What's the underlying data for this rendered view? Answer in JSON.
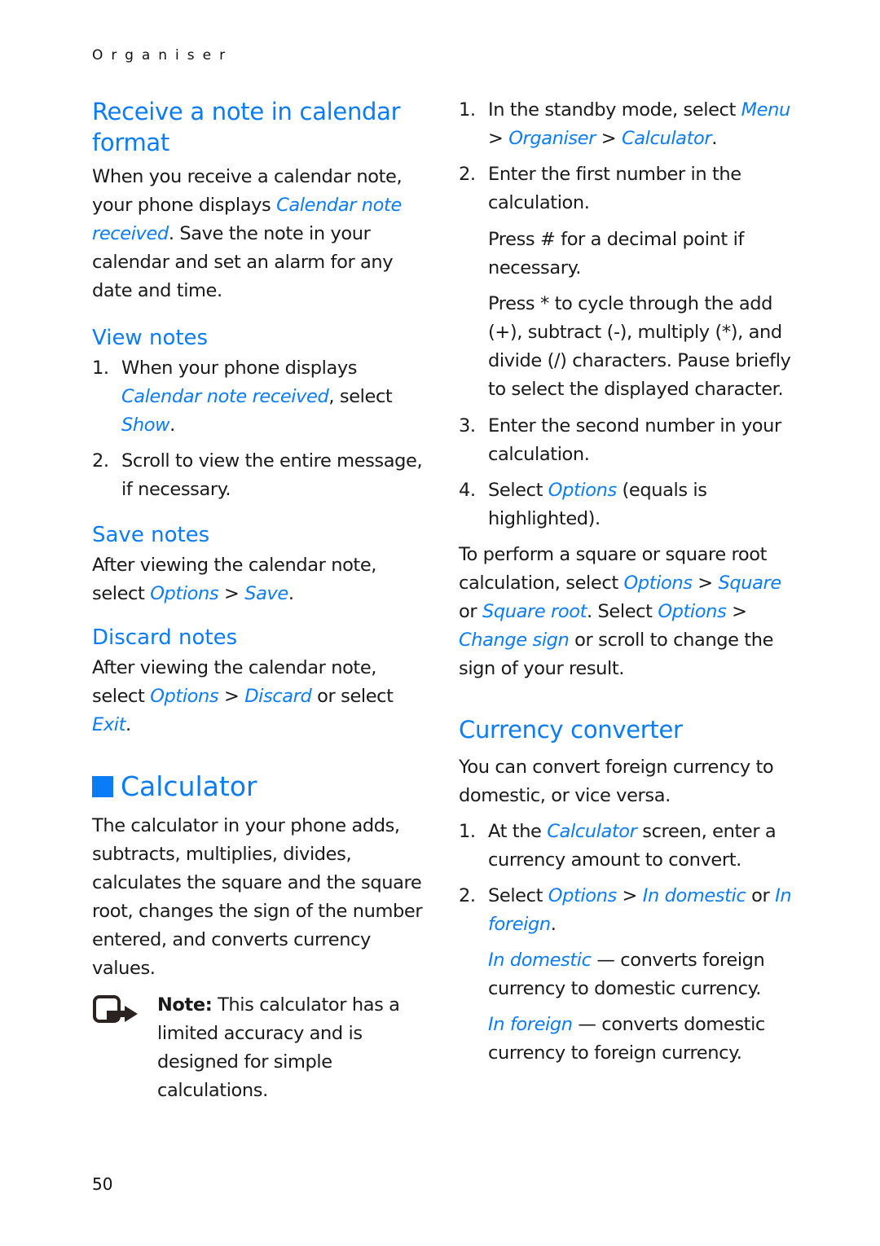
{
  "running_head": "Organiser",
  "page_number": "50",
  "left_column": {
    "receive_note": {
      "heading": "Receive a note in calendar format",
      "body": [
        {
          "t": "When you receive a calendar note, your phone displays "
        },
        {
          "t": "Calendar note received",
          "link": true
        },
        {
          "t": ". Save the note in your calendar and set an alarm for any date and time."
        }
      ]
    },
    "view_notes": {
      "heading": "View notes",
      "steps": [
        {
          "num": "1.",
          "parts": [
            {
              "t": "When your phone displays "
            },
            {
              "t": "Calendar note received",
              "link": true
            },
            {
              "t": ", select "
            },
            {
              "t": "Show",
              "link": true
            },
            {
              "t": "."
            }
          ]
        },
        {
          "num": "2.",
          "parts": [
            {
              "t": "Scroll to view the entire message, if necessary."
            }
          ]
        }
      ]
    },
    "save_notes": {
      "heading": "Save notes",
      "body": [
        {
          "t": "After viewing the calendar note, select "
        },
        {
          "t": "Options",
          "link": true
        },
        {
          "t": " > "
        },
        {
          "t": "Save",
          "link": true
        },
        {
          "t": "."
        }
      ]
    },
    "discard_notes": {
      "heading": "Discard notes",
      "body": [
        {
          "t": "After viewing the calendar note, select "
        },
        {
          "t": "Options",
          "link": true
        },
        {
          "t": " > "
        },
        {
          "t": "Discard",
          "link": true
        },
        {
          "t": " or select "
        },
        {
          "t": "Exit",
          "link": true
        },
        {
          "t": "."
        }
      ]
    },
    "calculator": {
      "heading": "Calculator",
      "body": "The calculator in your phone adds, subtracts, multiplies, divides, calculates the square and the square root, changes the sign of the number entered, and converts currency values.",
      "note_label": "Note:",
      "note_text": " This calculator has a limited accuracy and is designed for simple calculations."
    }
  },
  "right_column": {
    "calc_steps": [
      {
        "num": "1.",
        "parts": [
          {
            "t": "In the standby mode, select "
          },
          {
            "t": "Menu",
            "link": true
          },
          {
            "t": " > "
          },
          {
            "t": "Organiser",
            "link": true
          },
          {
            "t": " > "
          },
          {
            "t": "Calculator",
            "link": true
          },
          {
            "t": "."
          }
        ]
      },
      {
        "num": "2.",
        "parts": [
          {
            "t": "Enter the first number in the calculation."
          }
        ]
      }
    ],
    "press_hash": "Press # for a decimal point if necessary.",
    "press_star": "Press * to cycle through the add (+), subtract (-), multiply (*), and divide (/) characters. Pause briefly to select the displayed character.",
    "calc_steps_2": [
      {
        "num": "3.",
        "parts": [
          {
            "t": "Enter the second number in your calculation."
          }
        ]
      },
      {
        "num": "4.",
        "parts": [
          {
            "t": "Select "
          },
          {
            "t": "Options",
            "link": true
          },
          {
            "t": " (equals is highlighted)."
          }
        ]
      }
    ],
    "square_para": [
      {
        "t": "To perform a square or square root calculation, select "
      },
      {
        "t": "Options",
        "link": true
      },
      {
        "t": " > "
      },
      {
        "t": "Square",
        "link": true
      },
      {
        "t": " or "
      },
      {
        "t": "Square root",
        "link": true
      },
      {
        "t": ". Select "
      },
      {
        "t": "Options",
        "link": true
      },
      {
        "t": " > "
      },
      {
        "t": "Change sign",
        "link": true
      },
      {
        "t": " or scroll to change the sign of your result."
      }
    ],
    "currency": {
      "heading": "Currency converter",
      "intro": "You can convert foreign currency to domestic, or vice versa.",
      "steps": [
        {
          "num": "1.",
          "parts": [
            {
              "t": "At the "
            },
            {
              "t": "Calculator",
              "link": true
            },
            {
              "t": " screen, enter a currency amount to convert."
            }
          ]
        },
        {
          "num": "2.",
          "parts": [
            {
              "t": "Select "
            },
            {
              "t": "Options",
              "link": true
            },
            {
              "t": " > "
            },
            {
              "t": "In domestic",
              "link": true
            },
            {
              "t": " or "
            },
            {
              "t": "In foreign",
              "link": true
            },
            {
              "t": "."
            }
          ]
        }
      ],
      "in_domestic": [
        {
          "t": "In domestic",
          "link": true
        },
        {
          "t": " — converts foreign currency to domestic currency."
        }
      ],
      "in_foreign": [
        {
          "t": "In foreign",
          "link": true
        },
        {
          "t": " — converts domestic currency to foreign currency."
        }
      ]
    }
  },
  "colors": {
    "accent": "#0a7cf5",
    "text": "#1a1a1a"
  }
}
